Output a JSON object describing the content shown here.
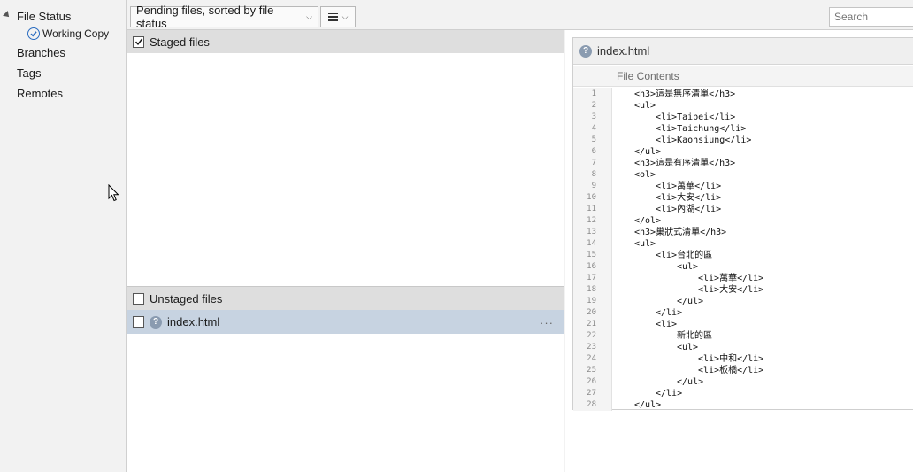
{
  "sidebar": {
    "file_status": "File Status",
    "working_copy": "Working Copy",
    "branches": "Branches",
    "tags": "Tags",
    "remotes": "Remotes"
  },
  "toolbar": {
    "sort_dropdown": "Pending files, sorted by file status",
    "search_placeholder": "Search"
  },
  "staged": {
    "label": "Staged files",
    "checked": true
  },
  "unstaged": {
    "label": "Unstaged files",
    "checked": false,
    "files": [
      {
        "name": "index.html",
        "status_icon": "question-icon",
        "more": "···"
      }
    ]
  },
  "preview": {
    "filename": "index.html",
    "subheader": "File Contents",
    "lines": [
      {
        "n": "1",
        "indent": 0,
        "text": "<h3>這是無序清單</h3>"
      },
      {
        "n": "2",
        "indent": 0,
        "text": "<ul>"
      },
      {
        "n": "3",
        "indent": 1,
        "text": "<li>Taipei</li>"
      },
      {
        "n": "4",
        "indent": 1,
        "text": "<li>Taichung</li>"
      },
      {
        "n": "5",
        "indent": 1,
        "text": "<li>Kaohsiung</li>"
      },
      {
        "n": "6",
        "indent": 0,
        "text": "</ul>"
      },
      {
        "n": "7",
        "indent": 0,
        "text": "<h3>這是有序清單</h3>"
      },
      {
        "n": "8",
        "indent": 0,
        "text": "<ol>"
      },
      {
        "n": "9",
        "indent": 1,
        "text": "<li>萬華</li>"
      },
      {
        "n": "10",
        "indent": 1,
        "text": "<li>大安</li>"
      },
      {
        "n": "11",
        "indent": 1,
        "text": "<li>內湖</li>"
      },
      {
        "n": "12",
        "indent": 0,
        "text": "</ol>"
      },
      {
        "n": "13",
        "indent": 0,
        "text": "<h3>巢狀式清單</h3>"
      },
      {
        "n": "14",
        "indent": 0,
        "text": "<ul>"
      },
      {
        "n": "15",
        "indent": 1,
        "text": "<li>台北的區"
      },
      {
        "n": "16",
        "indent": 2,
        "text": "<ul>"
      },
      {
        "n": "17",
        "indent": 3,
        "text": "<li>萬華</li>"
      },
      {
        "n": "18",
        "indent": 3,
        "text": "<li>大安</li>"
      },
      {
        "n": "19",
        "indent": 2,
        "text": "</ul>"
      },
      {
        "n": "20",
        "indent": 1,
        "text": "</li>"
      },
      {
        "n": "21",
        "indent": 1,
        "text": "<li>"
      },
      {
        "n": "22",
        "indent": 2,
        "text": "新北的區"
      },
      {
        "n": "23",
        "indent": 2,
        "text": "<ul>"
      },
      {
        "n": "24",
        "indent": 3,
        "text": "<li>中和</li>"
      },
      {
        "n": "25",
        "indent": 3,
        "text": "<li>板橋</li>"
      },
      {
        "n": "26",
        "indent": 2,
        "text": "</ul>"
      },
      {
        "n": "27",
        "indent": 1,
        "text": "</li>"
      },
      {
        "n": "28",
        "indent": 0,
        "text": "</ul>"
      }
    ]
  },
  "colors": {
    "selected_row": "#c7d3e1",
    "section_header": "#dedede",
    "accent": "#2a6cc0"
  }
}
